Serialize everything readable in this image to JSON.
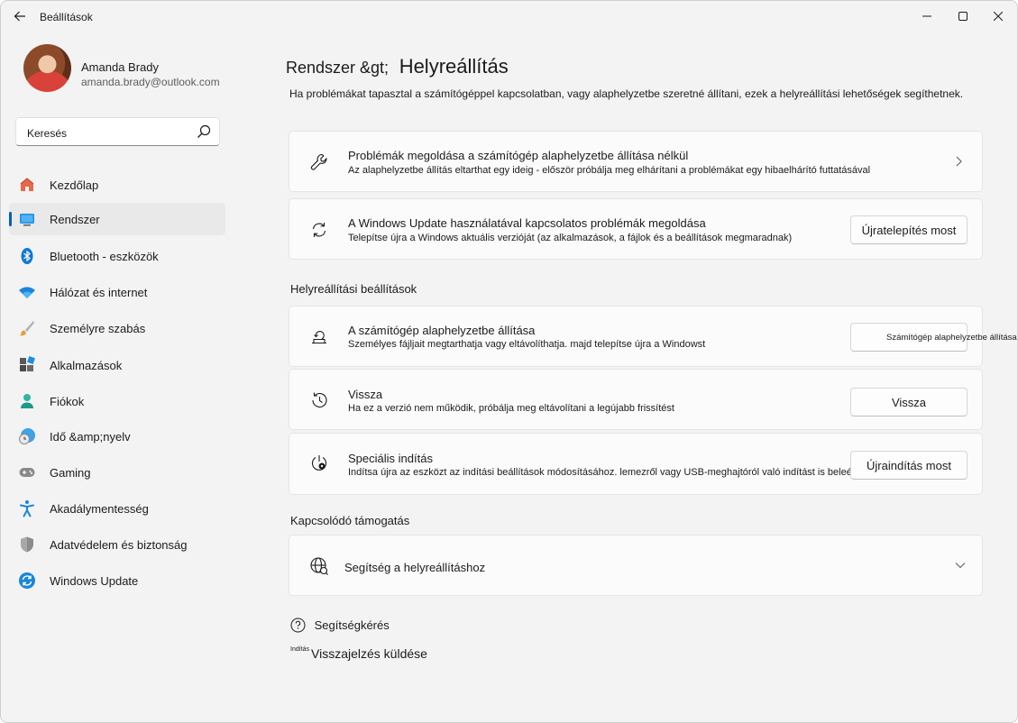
{
  "window": {
    "title": "Beállítások",
    "accent": "#005fb8"
  },
  "user": {
    "name": "Amanda Brady",
    "email": "amanda.brady@outlook.com"
  },
  "search": {
    "value": "Keresés"
  },
  "sidebar": {
    "items": [
      {
        "label": "Kezdőlap",
        "icon": "home-icon"
      },
      {
        "label": "Rendszer",
        "icon": "system-icon",
        "active": true
      },
      {
        "label": "Bluetooth - eszközök",
        "icon": "bluetooth-icon"
      },
      {
        "label": "Hálózat és internet",
        "icon": "wifi-icon"
      },
      {
        "label": "Személyre szabás",
        "icon": "brush-icon"
      },
      {
        "label": "Alkalmazások",
        "icon": "apps-icon"
      },
      {
        "label": "Fiókok",
        "icon": "account-icon"
      },
      {
        "label": "Idő &amp;nyelv",
        "icon": "time-language-icon"
      },
      {
        "label": "Gaming",
        "icon": "gamepad-icon"
      },
      {
        "label": "Akadálymentesség",
        "icon": "accessibility-icon"
      },
      {
        "label": "Adatvédelem és biztonság",
        "icon": "shield-icon"
      },
      {
        "label": "Windows Update",
        "icon": "update-icon"
      }
    ]
  },
  "header": {
    "breadcrumb_parent": "Rendszer &gt;",
    "title": "Helyreállítás",
    "description": "Ha problémákat tapasztal a számítógéppel kapcsolatban, vagy alaphelyzetbe szeretné állítani, ezek a helyreállítási lehetőségek segíthetnek."
  },
  "cards_top": {
    "troubleshoot": {
      "title": "Problémák megoldása a számítógép alaphelyzetbe állítása nélkül",
      "desc": "Az alaphelyzetbe állítás eltarthat egy ideig - először próbálja meg elhárítani a problémákat egy hibaelhárító futtatásával"
    },
    "update_fix": {
      "title": "A Windows Update használatával kapcsolatos problémák megoldása",
      "desc": "Telepítse újra a Windows aktuális verzióját (az alkalmazások, a fájlok és a beállítások megmaradnak)",
      "button": "Újratelepítés most"
    }
  },
  "recovery": {
    "heading": "Helyreállítási beállítások",
    "reset": {
      "title": "A számítógép alaphelyzetbe állítása",
      "desc": "Személyes fájljait megtarthatja vagy eltávolíthatja. majd telepítse újra a Windowst",
      "button": "Számítógép alaphelyzetbe állítása"
    },
    "goback": {
      "title": "Vissza",
      "desc": "Ha ez a verzió nem működik, próbálja meg eltávolítani a legújabb frissítést",
      "button": "Vissza"
    },
    "advanced": {
      "title": "Speciális indítás",
      "desc": "Indítsa újra az eszközt az indítási beállítások módosításához. lemezről vagy USB-meghajtóról való indítást is beleértve",
      "button": "Újraindítás most"
    }
  },
  "support": {
    "heading": "Kapcsolódó támogatás",
    "help_title": "Segítség a helyreállításhoz"
  },
  "footer": {
    "get_help": "Segítségkérés",
    "feedback_small": "Indítás",
    "feedback": "Visszajelzés küldése"
  }
}
